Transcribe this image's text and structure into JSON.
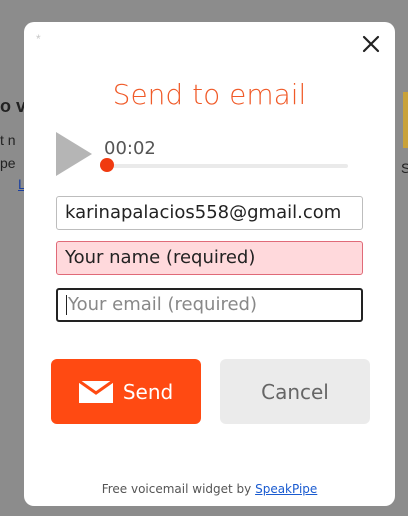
{
  "background": {
    "fragments": [
      "o v",
      "t n",
      "pe",
      "L",
      "S"
    ]
  },
  "modal": {
    "corner_mark": "*",
    "title": "Send to email",
    "close_icon": "close-icon",
    "player": {
      "time": "00:02",
      "progress": 0.0
    },
    "email_value": "karinapalacios558@gmail.com",
    "name_placeholder": "Your name (required)",
    "your_email_placeholder": "Your email (required)",
    "send_label": "Send",
    "send_icon": "envelope-icon",
    "cancel_label": "Cancel",
    "footer_text": "Free voicemail widget by ",
    "footer_link": "SpeakPipe"
  },
  "colors": {
    "accent": "#f05a28",
    "send_bg": "#ff4a12",
    "error_bg": "#ffd9dc"
  }
}
